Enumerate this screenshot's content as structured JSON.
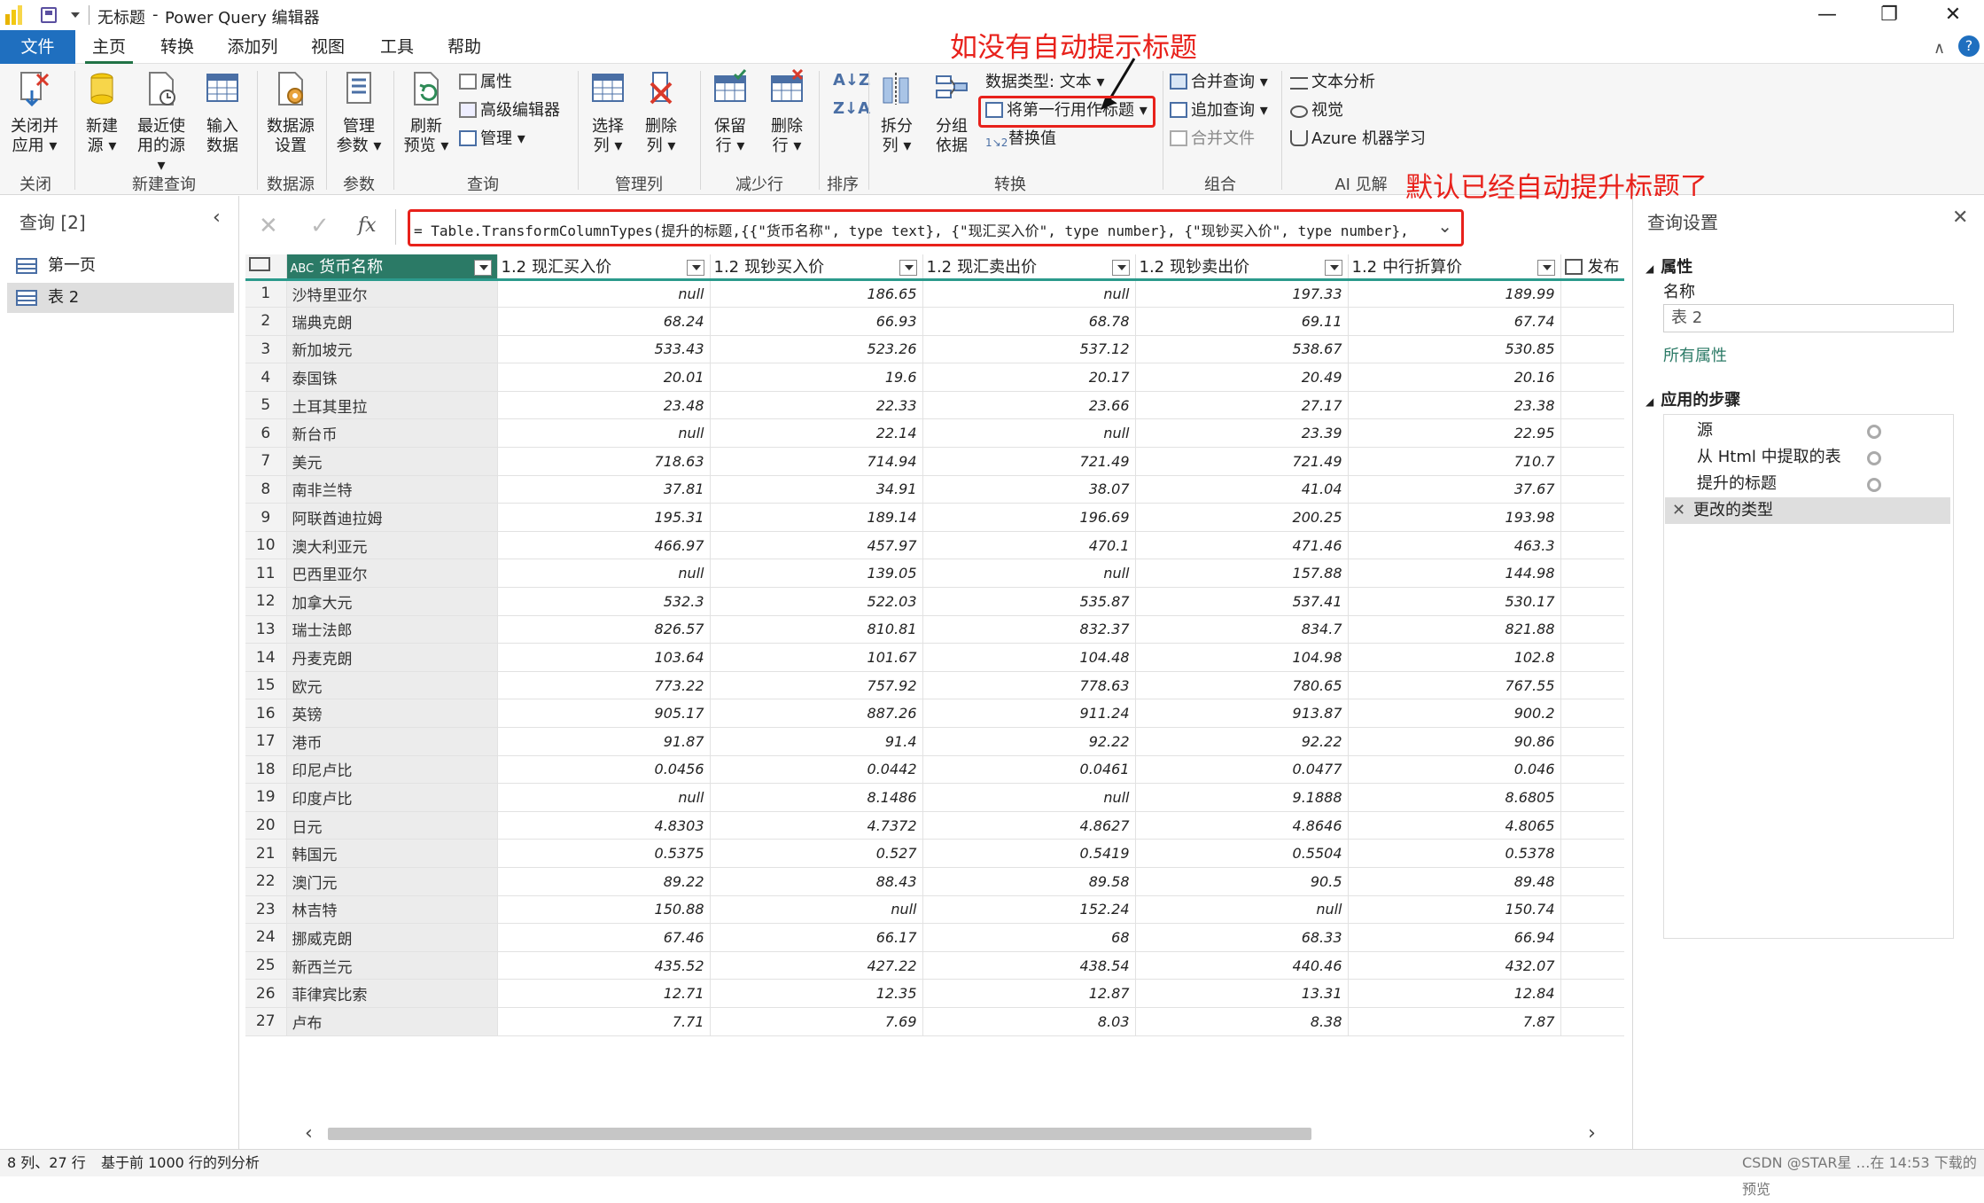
{
  "window": {
    "title_doc": "无标题",
    "title_app": "Power Query 编辑器",
    "minimize": "—",
    "maximize": "❐",
    "close": "✕"
  },
  "menu": {
    "file": "文件",
    "tabs": [
      "主页",
      "转换",
      "添加列",
      "视图",
      "工具",
      "帮助"
    ]
  },
  "ribbon": {
    "close_apply": [
      "关闭并",
      "应用"
    ],
    "new_source": [
      "新建",
      "源"
    ],
    "recent_sources": [
      "最近使",
      "用的源"
    ],
    "enter_data": [
      "输入",
      "数据"
    ],
    "datasource_settings": [
      "数据源",
      "设置"
    ],
    "manage_params": [
      "管理",
      "参数"
    ],
    "refresh_preview": [
      "刷新",
      "预览"
    ],
    "properties": "属性",
    "advanced_editor": "高级编辑器",
    "manage": "管理",
    "choose_columns": [
      "选择",
      "列"
    ],
    "remove_columns": [
      "删除",
      "列"
    ],
    "keep_rows": [
      "保留",
      "行"
    ],
    "remove_rows": [
      "删除",
      "行"
    ],
    "split_column": [
      "拆分",
      "列"
    ],
    "group_by": [
      "分组",
      "依据"
    ],
    "data_type": "数据类型: 文本",
    "use_first_row": "将第一行用作标题",
    "replace_values": "替换值",
    "merge_queries": "合并查询",
    "append_queries": "追加查询",
    "combine_files": "合并文件",
    "text_analytics": "文本分析",
    "vision": "视觉",
    "azure_ml": "Azure 机器学习",
    "groups": {
      "close": "关闭",
      "new_query": "新建查询",
      "data_sources": "数据源",
      "parameters": "参数",
      "query": "查询",
      "manage_columns": "管理列",
      "reduce_rows": "减少行",
      "sort": "排序",
      "transform": "转换",
      "combine": "组合",
      "ai": "AI 见解"
    }
  },
  "annotations": {
    "top": "如没有自动提示标题",
    "right": "默认已经自动提升标题了"
  },
  "queries": {
    "header": "查询 [2]",
    "items": [
      "第一页",
      "表 2"
    ]
  },
  "formula": {
    "text": "= Table.TransformColumnTypes(提升的标题,{{\"货币名称\", type text}, {\"现汇买入价\", type number}, {\"现钞买入价\", type number}, {\"现汇卖出价\","
  },
  "table": {
    "columns": [
      {
        "type": "ABC",
        "name": "货币名称"
      },
      {
        "type": "1.2",
        "name": "现汇买入价"
      },
      {
        "type": "1.2",
        "name": "现钞买入价"
      },
      {
        "type": "1.2",
        "name": "现汇卖出价"
      },
      {
        "type": "1.2",
        "name": "现钞卖出价"
      },
      {
        "type": "1.2",
        "name": "中行折算价"
      },
      {
        "type": "date",
        "name": "发布"
      }
    ],
    "rows": [
      [
        "沙特里亚尔",
        "null",
        "186.65",
        "null",
        "197.33",
        "189.99"
      ],
      [
        "瑞典克朗",
        "68.24",
        "66.93",
        "68.78",
        "69.11",
        "67.74"
      ],
      [
        "新加坡元",
        "533.43",
        "523.26",
        "537.12",
        "538.67",
        "530.85"
      ],
      [
        "泰国铢",
        "20.01",
        "19.6",
        "20.17",
        "20.49",
        "20.16"
      ],
      [
        "土耳其里拉",
        "23.48",
        "22.33",
        "23.66",
        "27.17",
        "23.38"
      ],
      [
        "新台币",
        "null",
        "22.14",
        "null",
        "23.39",
        "22.95"
      ],
      [
        "美元",
        "718.63",
        "714.94",
        "721.49",
        "721.49",
        "710.7"
      ],
      [
        "南非兰特",
        "37.81",
        "34.91",
        "38.07",
        "41.04",
        "37.67"
      ],
      [
        "阿联酋迪拉姆",
        "195.31",
        "189.14",
        "196.69",
        "200.25",
        "193.98"
      ],
      [
        "澳大利亚元",
        "466.97",
        "457.97",
        "470.1",
        "471.46",
        "463.3"
      ],
      [
        "巴西里亚尔",
        "null",
        "139.05",
        "null",
        "157.88",
        "144.98"
      ],
      [
        "加拿大元",
        "532.3",
        "522.03",
        "535.87",
        "537.41",
        "530.17"
      ],
      [
        "瑞士法郎",
        "826.57",
        "810.81",
        "832.37",
        "834.7",
        "821.88"
      ],
      [
        "丹麦克朗",
        "103.64",
        "101.67",
        "104.48",
        "104.98",
        "102.8"
      ],
      [
        "欧元",
        "773.22",
        "757.92",
        "778.63",
        "780.65",
        "767.55"
      ],
      [
        "英镑",
        "905.17",
        "887.26",
        "911.24",
        "913.87",
        "900.2"
      ],
      [
        "港币",
        "91.87",
        "91.4",
        "92.22",
        "92.22",
        "90.86"
      ],
      [
        "印尼卢比",
        "0.0456",
        "0.0442",
        "0.0461",
        "0.0477",
        "0.046"
      ],
      [
        "印度卢比",
        "null",
        "8.1486",
        "null",
        "9.1888",
        "8.6805"
      ],
      [
        "日元",
        "4.8303",
        "4.7372",
        "4.8627",
        "4.8646",
        "4.8065"
      ],
      [
        "韩国元",
        "0.5375",
        "0.527",
        "0.5419",
        "0.5504",
        "0.5378"
      ],
      [
        "澳门元",
        "89.22",
        "88.43",
        "89.58",
        "90.5",
        "89.48"
      ],
      [
        "林吉特",
        "150.88",
        "null",
        "152.24",
        "null",
        "150.74"
      ],
      [
        "挪威克朗",
        "67.46",
        "66.17",
        "68",
        "68.33",
        "66.94"
      ],
      [
        "新西兰元",
        "435.52",
        "427.22",
        "438.54",
        "440.46",
        "432.07"
      ],
      [
        "菲律宾比索",
        "12.71",
        "12.35",
        "12.87",
        "13.31",
        "12.84"
      ],
      [
        "卢布",
        "7.71",
        "7.69",
        "8.03",
        "8.38",
        "7.87"
      ]
    ]
  },
  "settings": {
    "title": "查询设置",
    "properties_header": "属性",
    "name_label": "名称",
    "name_value": "表 2",
    "all_properties": "所有属性",
    "steps_header": "应用的步骤",
    "steps": [
      "源",
      "从 Html 中提取的表",
      "提升的标题",
      "更改的类型"
    ]
  },
  "status": {
    "left": "8 列、27 行",
    "middle": "基于前 1000 行的列分析",
    "right": "CSDN @STAR星 …在 14:53 下载的预览"
  },
  "colors": {
    "accent_teal": "#2b9a8c",
    "file_tab": "#1f6fbf",
    "annotation_red": "#e8211b"
  }
}
